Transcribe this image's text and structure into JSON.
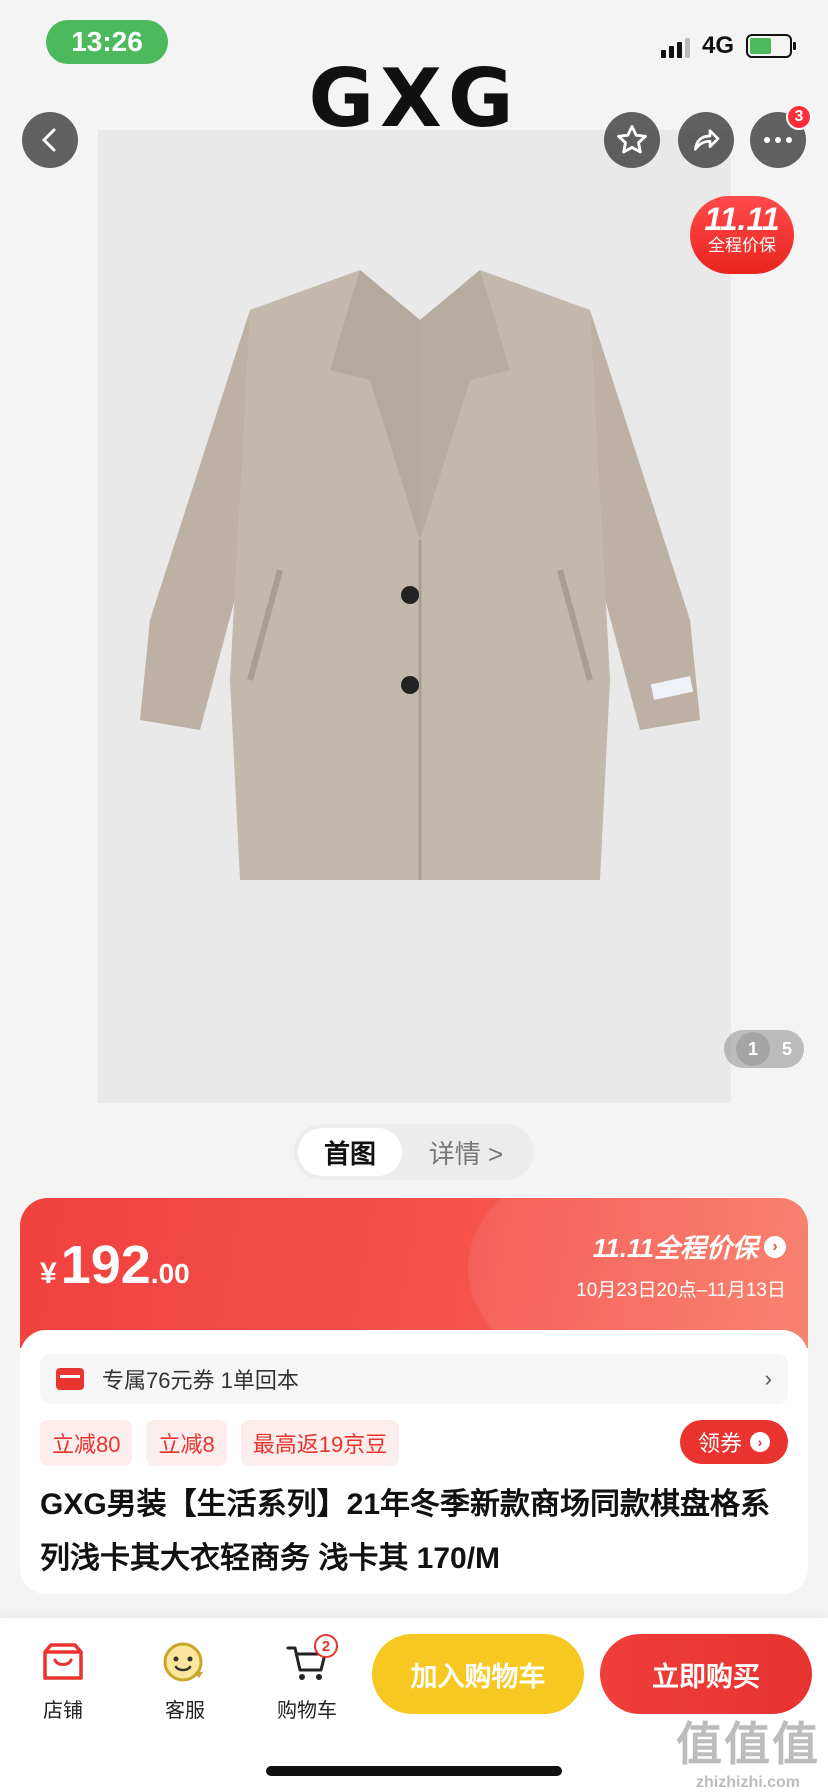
{
  "status_bar": {
    "time": "13:26",
    "network": "4G"
  },
  "brand": {
    "logo_text": "GXG"
  },
  "header": {
    "notification_count": "3",
    "promo_badge": {
      "line1": "11.11",
      "line2": "全程价保"
    },
    "image_pager": {
      "current": "1",
      "total": "5"
    }
  },
  "tabs": {
    "main_image": "首图",
    "details": "详情 >"
  },
  "price_banner": {
    "currency": "¥",
    "price_integer": "192",
    "price_decimal": ".00",
    "protect_title": "11.11全程价保",
    "protect_dates": "10月23日20点–11月13日"
  },
  "info": {
    "coupon_text": "专属76元券 1单回本",
    "coupon_chevron": "›",
    "tags": [
      "立减80",
      "立减8",
      "最高返19京豆"
    ],
    "coupon_button": "领券",
    "title": "GXG男装【生活系列】21年冬季新款商场同款棋盘格系列浅卡其大衣轻商务 浅卡其 170/M"
  },
  "bottom_bar": {
    "shop": "店铺",
    "service": "客服",
    "cart": "购物车",
    "cart_count": "2",
    "add_to_cart": "加入购物车",
    "buy_now": "立即购买"
  },
  "watermark": {
    "big": "值值值",
    "small": "zhizhizhi.com"
  },
  "colors": {
    "accent": "#e8332e",
    "cart_button": "#f6c821",
    "status_green": "#4cba5c"
  }
}
